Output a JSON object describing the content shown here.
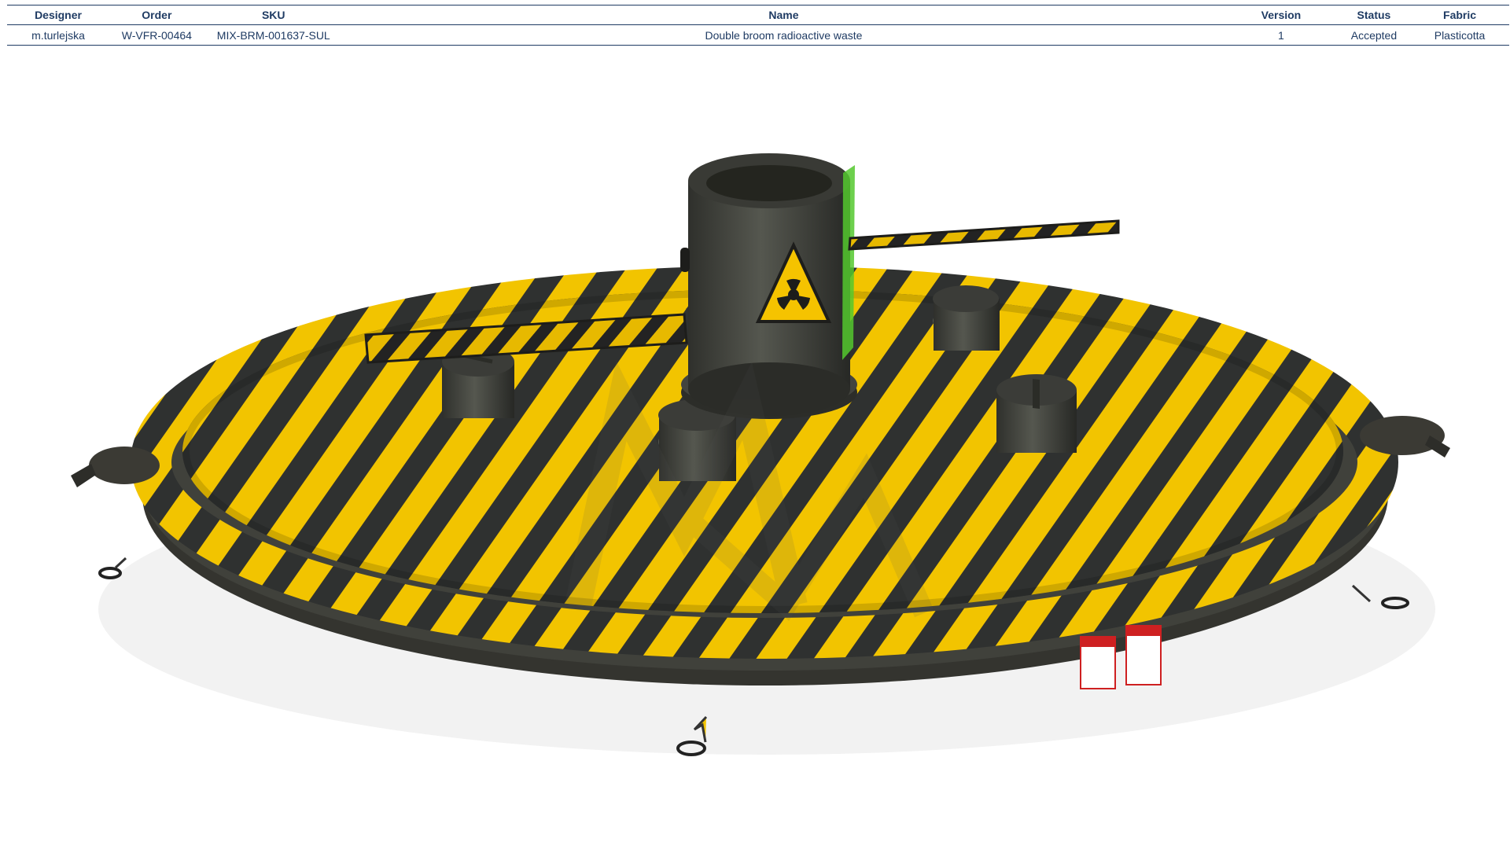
{
  "table": {
    "headers": {
      "designer": "Designer",
      "order": "Order",
      "sku": "SKU",
      "name": "Name",
      "version": "Version",
      "status": "Status",
      "fabric": "Fabric"
    },
    "row": {
      "designer": "m.turlejska",
      "order": "W-VFR-00464",
      "sku": "MIX-BRM-001637-SUL",
      "name": "Double broom radioactive waste",
      "version": "1",
      "status": "Accepted",
      "fabric": "Plasticotta"
    }
  },
  "render": {
    "subject": "inflatable-radioactive-waste-arena",
    "colors": {
      "header_text": "#1f3b63",
      "yellow": "#f2c400",
      "dark": "#3b3a34",
      "hazard_symbol": "#1b1b1b",
      "green_accent": "#52c92f"
    },
    "watermark": "MW"
  }
}
